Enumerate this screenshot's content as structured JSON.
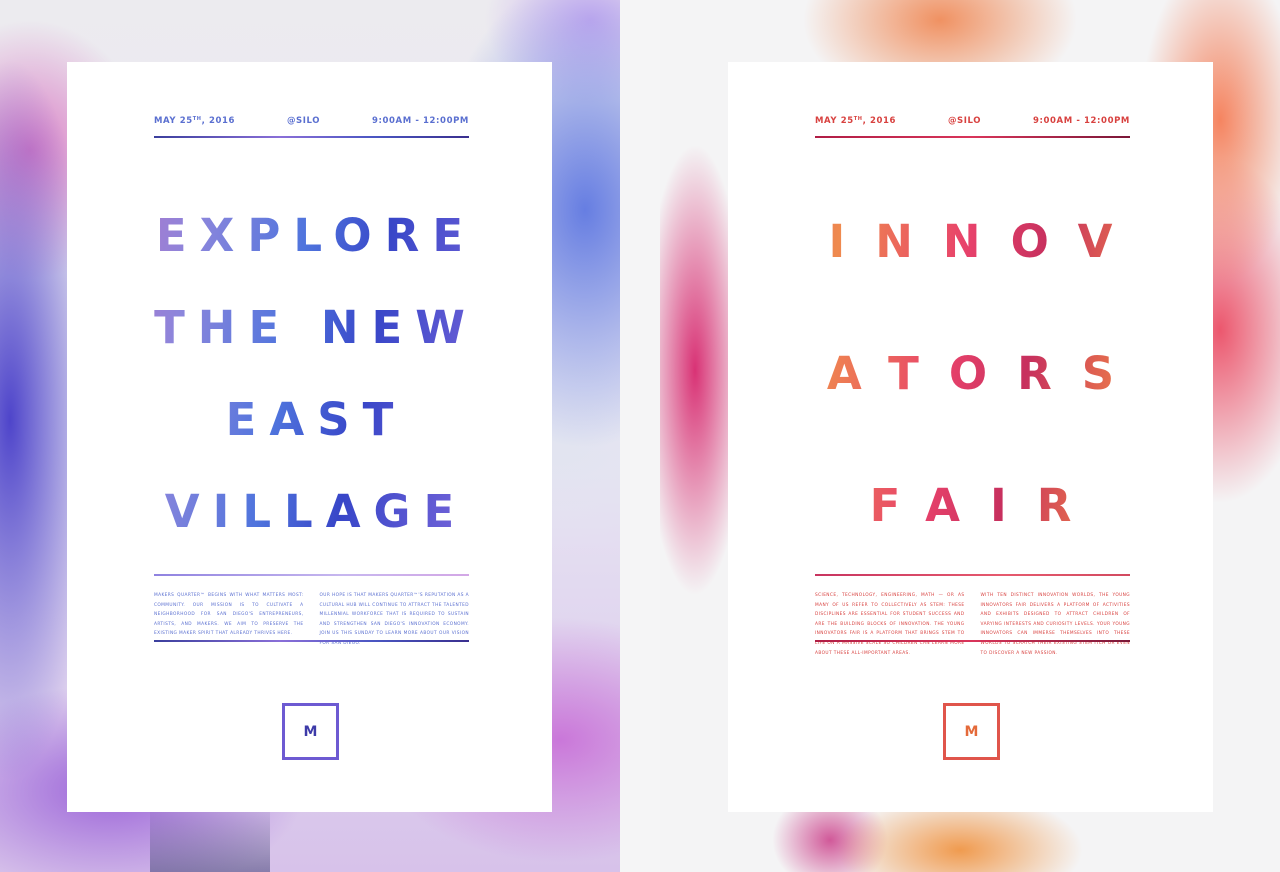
{
  "posters": [
    {
      "date": "MAY 25",
      "date_suffix": "TH",
      "date_year": ", 2016",
      "venue": "@SILO",
      "time": "9:00AM - 12:00PM",
      "headline_lines": [
        "EXPLORE",
        "THE NEW",
        "EAST",
        "VILLAGE"
      ],
      "body_col1": "MAKERS QUARTER™ BEGINS WITH WHAT MATTERS MOST: COMMUNITY. OUR MISSION IS TO CULTIVATE A NEIGHBORHOOD FOR SAN DIEGO'S ENTREPRENEURS, ARTISTS, AND MAKERS. WE AIM TO PRESERVE THE EXISTING MAKER SPIRIT THAT ALREADY THRIVES HERE.",
      "body_col2": "OUR HOPE IS THAT MAKERS QUARTER™'S REPUTATION AS A CULTURAL HUB WILL CONTINUE TO ATTRACT THE TALENTED MILLENNIAL WORKFORCE THAT IS REQUIRED TO SUSTAIN AND STRENGTHEN SAN DIEGO'S INNOVATION ECONOMY. JOIN US THIS SUNDAY TO LEARN MORE ABOUT OUR VISION FOR SAN DIEGO.",
      "logo_letter": "M",
      "accent_color": "#5a6fd0"
    },
    {
      "date": "MAY 25",
      "date_suffix": "TH",
      "date_year": ", 2016",
      "venue": "@SILO",
      "time": "9:00AM - 12:00PM",
      "headline_lines": [
        "INNOV",
        "ATORS",
        "FAIR"
      ],
      "body_col1": "SCIENCE, TECHNOLOGY, ENGINEERING, MATH — OR AS MANY OF US REFER TO COLLECTIVELY AS STEM: THESE DISCIPLINES ARE ESSENTIAL FOR STUDENT SUCCESS AND ARE THE BUILDING BLOCKS OF INNOVATION. THE YOUNG INNOVATORS FAIR IS A PLATFORM THAT BRINGS STEM TO LIFE ON A MASSIVE SCALE SO CHILDREN CAN LEARN MORE ABOUT THESE ALL-IMPORTANT AREAS.",
      "body_col2": "WITH TEN DISTINCT INNOVATION WORLDS, THE YOUNG INNOVATORS FAIR DELIVERS A PLATFORM OF ACTIVITIES AND EXHIBITS DESIGNED TO ATTRACT CHILDREN OF VARYING INTERESTS AND CURIOSITY LEVELS. YOUR YOUNG INNOVATORS CAN IMMERSE THEMSELVES INTO THESE WORLDS TO SCRATCH THEIR EXISTING STEM ITCH OR EVEN TO DISCOVER A NEW PASSION.",
      "logo_letter": "M",
      "accent_color": "#d8413f"
    }
  ]
}
